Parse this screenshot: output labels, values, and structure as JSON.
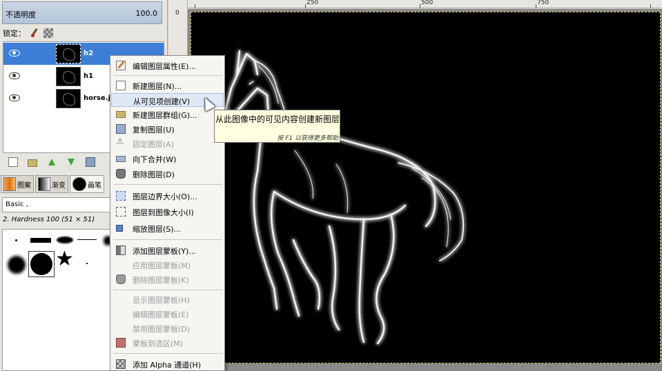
{
  "layers_panel": {
    "opacity_label": "不透明度",
    "opacity_value": "100.0",
    "lock_label": "锁定：",
    "layers": [
      {
        "name": "h2",
        "selected": true
      },
      {
        "name": "h1",
        "selected": false
      },
      {
        "name": "horse.jpg",
        "selected": false
      }
    ]
  },
  "dock_tabs": [
    {
      "label": "图案",
      "icon": "pattern-icon"
    },
    {
      "label": "渐变",
      "icon": "gradient-icon"
    },
    {
      "label": "画笔",
      "icon": "brush-icon"
    }
  ],
  "brushes": {
    "filter_value": "Basic ,",
    "selected_name": "2. Hardness 100 (51 × 51)"
  },
  "ruler": {
    "top_labels": [
      "250",
      "500",
      "750"
    ],
    "left_label": "0"
  },
  "context_menu": {
    "items": [
      {
        "label": "编辑图层属性(E)...",
        "icon": "edit-layer-icon",
        "disabled": false
      },
      {
        "sep": true
      },
      {
        "label": "新建图层(N)...",
        "icon": "new-layer-icon",
        "disabled": false
      },
      {
        "label": "从可见项创建(V)",
        "icon": "",
        "disabled": false,
        "hover": true
      },
      {
        "label": "新建图层群组(G)...",
        "icon": "new-group-icon",
        "disabled": false
      },
      {
        "label": "复制图层(U)",
        "icon": "duplicate-layer-icon",
        "disabled": false
      },
      {
        "label": "固定图层(A)",
        "icon": "anchor-icon",
        "disabled": true
      },
      {
        "label": "向下合并(W)",
        "icon": "merge-down-icon",
        "disabled": false
      },
      {
        "label": "删除图层(D)",
        "icon": "delete-layer-icon",
        "disabled": false
      },
      {
        "sep": true
      },
      {
        "label": "图层边界大小(O)...",
        "icon": "layer-boundary-icon",
        "disabled": false
      },
      {
        "label": "图层到图像大小(I)",
        "icon": "layer-to-image-icon",
        "disabled": false
      },
      {
        "label": "缩放图层(S)...",
        "icon": "scale-layer-icon",
        "disabled": false
      },
      {
        "sep": true
      },
      {
        "label": "添加图层蒙板(Y)...",
        "icon": "add-mask-icon",
        "disabled": false
      },
      {
        "label": "应用图层蒙板(M)",
        "icon": "",
        "disabled": true
      },
      {
        "label": "删除图层蒙板(K)",
        "icon": "delete-mask-icon",
        "disabled": true
      },
      {
        "sep": true
      },
      {
        "label": "显示图层蒙板(H)",
        "icon": "",
        "disabled": true
      },
      {
        "label": "编辑图层蒙板(E)",
        "icon": "",
        "disabled": true
      },
      {
        "label": "禁用图层蒙板(D)",
        "icon": "",
        "disabled": true
      },
      {
        "label": "蒙板到选区(M)",
        "icon": "mask-to-selection-icon",
        "disabled": true
      },
      {
        "sep": true
      },
      {
        "label": "添加 Alpha 通道(H)",
        "icon": "alpha-channel-icon",
        "disabled": false
      }
    ]
  },
  "tooltip": {
    "text": "从此图像中的可见内容创建新图层",
    "hint": "按 F1 以获得更多帮助"
  }
}
